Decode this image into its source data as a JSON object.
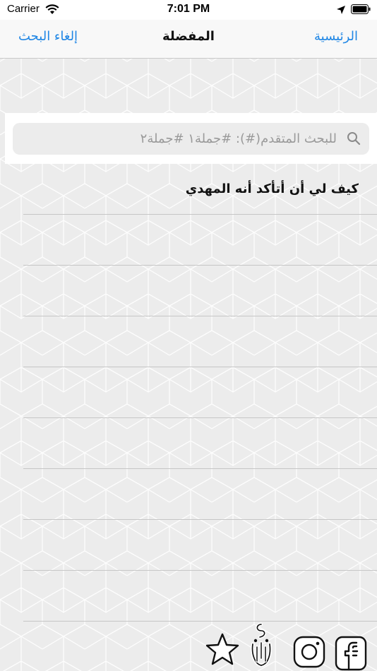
{
  "status_bar": {
    "carrier": "Carrier",
    "time": "7:01 PM"
  },
  "nav": {
    "left_label": "إلغاء البحث",
    "title": "المفضلة",
    "right_label": "الرئيسية"
  },
  "search": {
    "placeholder": "للبحث المتقدم(#): #جملة١ #جملة٢"
  },
  "list": {
    "items": [
      {
        "text": "كيف لي أن أتأكد أنه المهدي"
      }
    ]
  },
  "colors": {
    "accent": "#1f86e5",
    "background": "#efefef"
  },
  "icons": {
    "bottom": [
      "star-icon",
      "calligraphy-logo-icon",
      "instagram-icon",
      "facebook-icon"
    ]
  }
}
